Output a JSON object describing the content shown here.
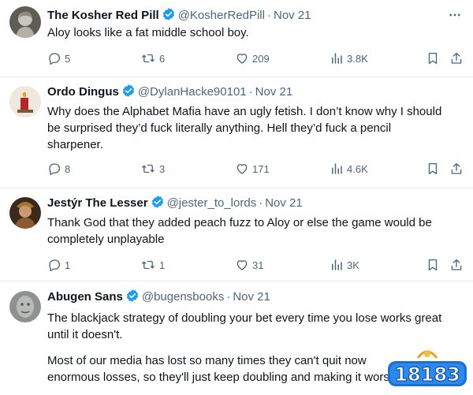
{
  "tweets": [
    {
      "name": "The Kosher Red Pill",
      "handle": "@KosherRedPill",
      "date": "Nov 21",
      "lines": [
        "Aloy looks like a fat middle school boy."
      ],
      "replies": "5",
      "reposts": "6",
      "likes": "209",
      "views": "3.8K",
      "avatar_icon": "statue-bust-avatar"
    },
    {
      "name": "Ordo Dingus",
      "handle": "@DylanHacke90101",
      "date": "Nov 21",
      "lines": [
        "Why does the Alphabet Mafia have an ugly fetish. I don’t know why I should",
        "be surprised they’d fuck literally anything. Hell they’d fuck a pencil",
        "sharpener."
      ],
      "replies": "8",
      "reposts": "3",
      "likes": "171",
      "views": "4.6K",
      "avatar_icon": "red-candle-avatar"
    },
    {
      "name": "Jestýr The Lesser",
      "handle": "@jester_to_lords",
      "date": "Nov 21",
      "lines": [
        "Thank God that they added peach fuzz to Aloy or else the game would be",
        "completely unplayable"
      ],
      "replies": "1",
      "reposts": "1",
      "likes": "31",
      "views": "3K",
      "avatar_icon": "jester-portrait-avatar"
    },
    {
      "name": "Abugen Sans",
      "handle": "@bugensbooks",
      "date": "Nov 21",
      "lines": [
        "The blackjack strategy of doubling your bet every time you lose works great",
        "until it doesn't.",
        "",
        "Most of our media has lost so many times they can't quit now",
        "enormous losses, so they'll just keep doubling and making it worse."
      ],
      "avatar_icon": "stone-face-avatar"
    }
  ],
  "colors": {
    "verified": "#1d9bf0",
    "text": "#0f1419",
    "muted": "#536471",
    "divider": "#e6ecf0"
  },
  "watermark": {
    "text": "18183"
  }
}
